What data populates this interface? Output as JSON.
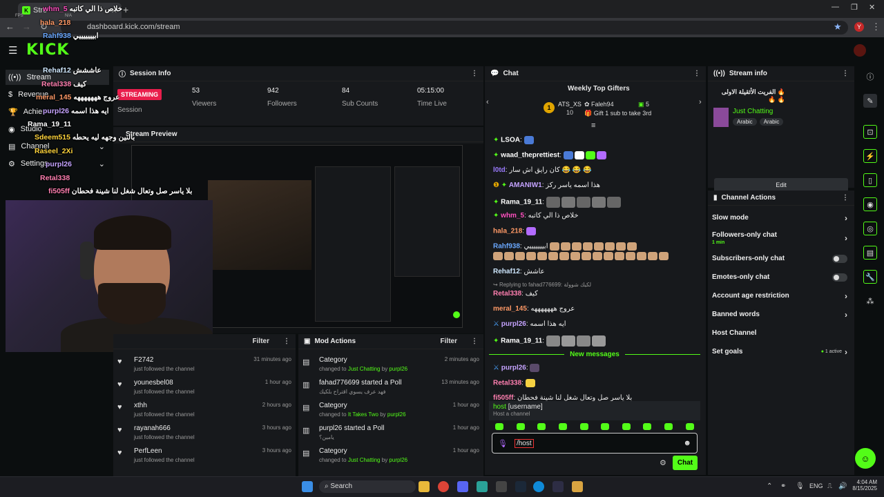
{
  "browser": {
    "tab_title": "Stre",
    "url": "dashboard.kick.com/stream",
    "fps_label": "FPS",
    "na_label": "N/A"
  },
  "logo": "KICK",
  "nav": [
    {
      "label": "Stream",
      "icon": "broadcast-icon"
    },
    {
      "label": "Revenue",
      "icon": "dollar-icon"
    },
    {
      "label": "Achie",
      "icon": "trophy-icon"
    },
    {
      "label": "Studio",
      "icon": "studio-icon"
    },
    {
      "label": "Channel",
      "icon": "channel-icon"
    },
    {
      "label": "Settings",
      "icon": "gear-icon"
    }
  ],
  "session": {
    "title": "Session Info",
    "badge": "STREAMING",
    "session_label": "Session",
    "stats": [
      {
        "value": "53",
        "label": "Viewers"
      },
      {
        "value": "942",
        "label": "Followers"
      },
      {
        "value": "84",
        "label": "Sub Counts"
      },
      {
        "value": "05:15:00",
        "label": "Time Live"
      }
    ]
  },
  "preview": {
    "title": "Stream Preview"
  },
  "followers": {
    "filter": "Filter",
    "rows": [
      {
        "name": "F2742",
        "sub": "just followed the channel",
        "time": "31 minutes ago"
      },
      {
        "name": "younesbel08",
        "sub": "just followed the channel",
        "time": "1 hour ago"
      },
      {
        "name": "xthh",
        "sub": "just followed the channel",
        "time": "2 hours ago"
      },
      {
        "name": "rayanah666",
        "sub": "just followed the channel",
        "time": "3 hours ago"
      },
      {
        "name": "PerfLeen",
        "sub": "just followed the channel",
        "time": "3 hours ago"
      }
    ]
  },
  "mod_actions": {
    "title": "Mod Actions",
    "filter": "Filter",
    "rows": [
      {
        "title": "Category",
        "pre": "changed to ",
        "g1": "Just Chatting",
        "mid": " by ",
        "g2": "purpl26",
        "time": "2 minutes ago",
        "icon": "category-icon"
      },
      {
        "title": "fahad776699 started a Poll",
        "pre": "فهد عرف يسوي اقتراح بلكيك",
        "g1": "",
        "mid": "",
        "g2": "",
        "time": "13 minutes ago",
        "icon": "poll-icon"
      },
      {
        "title": "Category",
        "pre": "changed to ",
        "g1": "It Takes Two",
        "mid": " by ",
        "g2": "purpl26",
        "time": "1 hour ago",
        "icon": "category-icon"
      },
      {
        "title": "purpl26 started a Poll",
        "pre": "يامين؟",
        "g1": "",
        "mid": "",
        "g2": "",
        "time": "1 hour ago",
        "icon": "poll-icon"
      },
      {
        "title": "Category",
        "pre": "changed to ",
        "g1": "Just Chatting",
        "mid": " by ",
        "g2": "purpl26",
        "time": "1 hour ago",
        "icon": "category-icon"
      }
    ]
  },
  "chat": {
    "title": "Chat",
    "gifters_title": "Weekly Top Gifters",
    "gifter1": {
      "name": "ATS_XS",
      "count": "10"
    },
    "gifter2": {
      "name": "Faleh94",
      "count": "5"
    },
    "gift_hint": "Gift 1 sub to take 3rd",
    "messages": [
      {
        "user": "LSOA",
        "color": "#ffffff",
        "text": ""
      },
      {
        "user": "waad_theprettiest",
        "color": "#ffffff",
        "text": ""
      },
      {
        "user": "l0td",
        "color": "#9b7bff",
        "text": "كان رايق اش سار 😂 😂 😂"
      },
      {
        "user": "AMANIW1",
        "color": "#c5a3ff",
        "text": "هذا اسمه ياسر ركز"
      },
      {
        "user": "Rama_19_11",
        "color": "#ffffff",
        "text": ""
      },
      {
        "user": "whm_5",
        "color": "#ff4fbf",
        "text": "خلاص ذا الي كاتبه"
      },
      {
        "user": "hala_218",
        "color": "#ff9966",
        "text": ""
      },
      {
        "user": "Rahf938",
        "color": "#6aa8ff",
        "text": "ابيييييييي"
      },
      {
        "user": "Rehaf12",
        "color": "#cfe8ff",
        "text": "عاشش"
      },
      {
        "user": "Retal338",
        "color": "#ff7fb0",
        "text": "كيف"
      },
      {
        "user": "meral_145",
        "color": "#ff9966",
        "text": "عروج هههههههه"
      },
      {
        "user": "purpl26",
        "color": "#c5a3ff",
        "text": "ايه هذا اسمه"
      },
      {
        "user": "Rama_19_11",
        "color": "#ffffff",
        "text": ""
      },
      {
        "user": "purpl26",
        "color": "#c5a3ff",
        "text": ""
      },
      {
        "user": "Retal338",
        "color": "#ff7fb0",
        "text": ""
      },
      {
        "user": "fi505ff",
        "color": "#ff7fb0",
        "text": "بلا ياسر صل وتعال شغل لنا شينة فحطان"
      }
    ],
    "reply_hint": "Replying to fahad776699: لكيك شوولة",
    "new_messages": "New messages",
    "host_cmd": "host",
    "host_arg": "[username]",
    "host_desc": "Host a channel",
    "input_value": "/host",
    "send": "Chat"
  },
  "stream_info": {
    "title": "Stream info",
    "stream_title": "الفريت الأثقيلة الاولى 🔥 🔥 🔥",
    "category": "Just Chatting",
    "tags": [
      "Arabic",
      "Arabic"
    ],
    "edit": "Edit"
  },
  "channel_actions": {
    "title": "Channel Actions",
    "items": [
      {
        "label": "Slow mode",
        "kind": "arrow"
      },
      {
        "label": "Followers-only chat",
        "sub": "1 min",
        "kind": "arrow"
      },
      {
        "label": "Subscribers-only chat",
        "kind": "toggle"
      },
      {
        "label": "Emotes-only chat",
        "kind": "toggle"
      },
      {
        "label": "Account age restriction",
        "kind": "arrow"
      },
      {
        "label": "Banned words",
        "kind": "arrow"
      },
      {
        "label": "Host Channel",
        "kind": "none"
      },
      {
        "label": "Set goals",
        "sub": "1 active",
        "kind": "arrow"
      }
    ]
  },
  "overlay_chat": [
    {
      "user": "whm_5",
      "text": "خلاص ذا الي كاتبه"
    },
    {
      "user": "hala_218",
      "text": ""
    },
    {
      "user": "Rahf938",
      "text": "ابيييييييي"
    },
    {
      "user": "Rehaf12",
      "text": "عاششش"
    },
    {
      "user": "Retal338",
      "text": "كيف"
    },
    {
      "user": "meral_145",
      "text": "عروج هههههههه"
    },
    {
      "user": "purpl26",
      "text": "ايه هذا اسمه"
    },
    {
      "user": "Rama_19_11",
      "text": ""
    },
    {
      "user": "Sdeem515",
      "text": "بالنين وجهه ليه يحطه"
    },
    {
      "user": "Raseel_2Xi",
      "text": ""
    },
    {
      "user": "purpl26",
      "text": ""
    },
    {
      "user": "Retal338",
      "text": ""
    },
    {
      "user": "fi505ff",
      "text": "بلا ياسر صل وتعال شغل لنا شينة فحطان"
    }
  ],
  "taskbar": {
    "search": "Search",
    "lang": "ENG",
    "time": "4:04 AM",
    "date": "8/15/2025"
  }
}
